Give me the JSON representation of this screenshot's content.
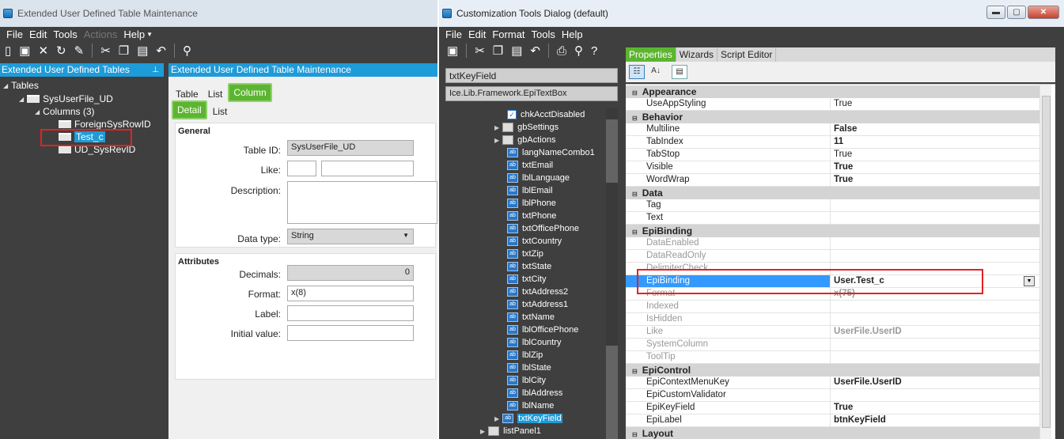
{
  "left_window": {
    "title": "Extended User Defined Table Maintenance",
    "menu": [
      "File",
      "Edit",
      "Tools",
      "Actions",
      "Help"
    ],
    "tree_panel_title": "Extended User Defined Tables",
    "tree": {
      "root": "Tables",
      "table": "SysUserFile_UD",
      "columns": "Columns (3)",
      "col1": "ForeignSysRowID",
      "col2": "Test_c",
      "col3": "UD_SysRevID"
    },
    "detail_panel_title": "Extended User Defined Table Maintenance",
    "tabs": [
      "Table",
      "List",
      "Column"
    ],
    "subtabs": [
      "Detail",
      "List"
    ],
    "general": {
      "heading": "General",
      "table_id_label": "Table ID:",
      "table_id_value": "SysUserFile_UD",
      "like_label": "Like:",
      "description_label": "Description:",
      "datatype_label": "Data type:",
      "datatype_value": "String"
    },
    "attributes": {
      "heading": "Attributes",
      "decimals_label": "Decimals:",
      "decimals_value": "0",
      "format_label": "Format:",
      "format_value": "x(8)",
      "label_label": "Label:",
      "initial_label": "Initial value:"
    }
  },
  "right_window": {
    "title": "Customization Tools Dialog (default)",
    "menu": [
      "File",
      "Edit",
      "Format",
      "Tools",
      "Help"
    ],
    "selected_control": "txtKeyField",
    "control_type": "Ice.Lib.Framework.EpiTextBox",
    "tree_items": [
      {
        "label": "chkAcctDisabled",
        "icon": "checkbox-icon"
      },
      {
        "label": "gbSettings",
        "icon": "groupbox-icon"
      },
      {
        "label": "gbActions",
        "icon": "groupbox-icon"
      },
      {
        "label": "langNameCombo1",
        "icon": "textbox-icon"
      },
      {
        "label": "txtEmail",
        "icon": "textbox-icon"
      },
      {
        "label": "lblLanguage",
        "icon": "textbox-icon"
      },
      {
        "label": "lblEmail",
        "icon": "textbox-icon"
      },
      {
        "label": "lblPhone",
        "icon": "textbox-icon"
      },
      {
        "label": "txtPhone",
        "icon": "textbox-icon"
      },
      {
        "label": "txtOfficePhone",
        "icon": "textbox-icon"
      },
      {
        "label": "txtCountry",
        "icon": "textbox-icon"
      },
      {
        "label": "txtZip",
        "icon": "textbox-icon"
      },
      {
        "label": "txtState",
        "icon": "textbox-icon"
      },
      {
        "label": "txtCity",
        "icon": "textbox-icon"
      },
      {
        "label": "txtAddress2",
        "icon": "textbox-icon"
      },
      {
        "label": "txtAddress1",
        "icon": "textbox-icon"
      },
      {
        "label": "txtName",
        "icon": "textbox-icon"
      },
      {
        "label": "lblOfficePhone",
        "icon": "textbox-icon"
      },
      {
        "label": "lblCountry",
        "icon": "textbox-icon"
      },
      {
        "label": "lblZip",
        "icon": "textbox-icon"
      },
      {
        "label": "lblState",
        "icon": "textbox-icon"
      },
      {
        "label": "lblCity",
        "icon": "textbox-icon"
      },
      {
        "label": "lblAddress",
        "icon": "textbox-icon"
      },
      {
        "label": "lblName",
        "icon": "textbox-icon"
      },
      {
        "label": "txtKeyField",
        "icon": "textbox-icon"
      },
      {
        "label": "listPanel1",
        "icon": "panel-icon"
      }
    ],
    "tabs": [
      "Properties",
      "Wizards",
      "Script Editor"
    ],
    "cat_appearance": "Appearance",
    "cat_behavior": "Behavior",
    "cat_data": "Data",
    "cat_epibinding": "EpiBinding",
    "cat_epicontrol": "EpiControl",
    "cat_layout": "Layout",
    "props": {
      "useappstyling": {
        "k": "UseAppStyling",
        "v": "True"
      },
      "multiline": {
        "k": "Multiline",
        "v": "False"
      },
      "tabindex": {
        "k": "TabIndex",
        "v": "11"
      },
      "tabstop": {
        "k": "TabStop",
        "v": "True"
      },
      "visible": {
        "k": "Visible",
        "v": "True"
      },
      "wordwrap": {
        "k": "WordWrap",
        "v": "True"
      },
      "tag": {
        "k": "Tag",
        "v": ""
      },
      "text": {
        "k": "Text",
        "v": ""
      },
      "dataenabled": {
        "k": "DataEnabled",
        "v": ""
      },
      "datareadonly": {
        "k": "DataReadOnly",
        "v": ""
      },
      "delimitercheck": {
        "k": "DelimiterCheck",
        "v": ""
      },
      "epibinding": {
        "k": "EpiBinding",
        "v": "User.Test_c"
      },
      "format": {
        "k": "Format",
        "v": "x(75)"
      },
      "indexed": {
        "k": "Indexed",
        "v": ""
      },
      "ishidden": {
        "k": "IsHidden",
        "v": ""
      },
      "like": {
        "k": "Like",
        "v": "UserFile.UserID"
      },
      "systemcolumn": {
        "k": "SystemColumn",
        "v": ""
      },
      "tooltip": {
        "k": "ToolTip",
        "v": ""
      },
      "epicontextmenukey": {
        "k": "EpiContextMenuKey",
        "v": "UserFile.UserID"
      },
      "epicustomvalidator": {
        "k": "EpiCustomValidator",
        "v": ""
      },
      "epikeyfield": {
        "k": "EpiKeyField",
        "v": "True"
      },
      "epilabel": {
        "k": "EpiLabel",
        "v": "btnKeyField"
      }
    }
  },
  "colors": {
    "accent_blue": "#1e9bd9",
    "active_tab_green": "#5cb531",
    "highlight_red": "#e32222",
    "selection_blue": "#3399ff"
  }
}
